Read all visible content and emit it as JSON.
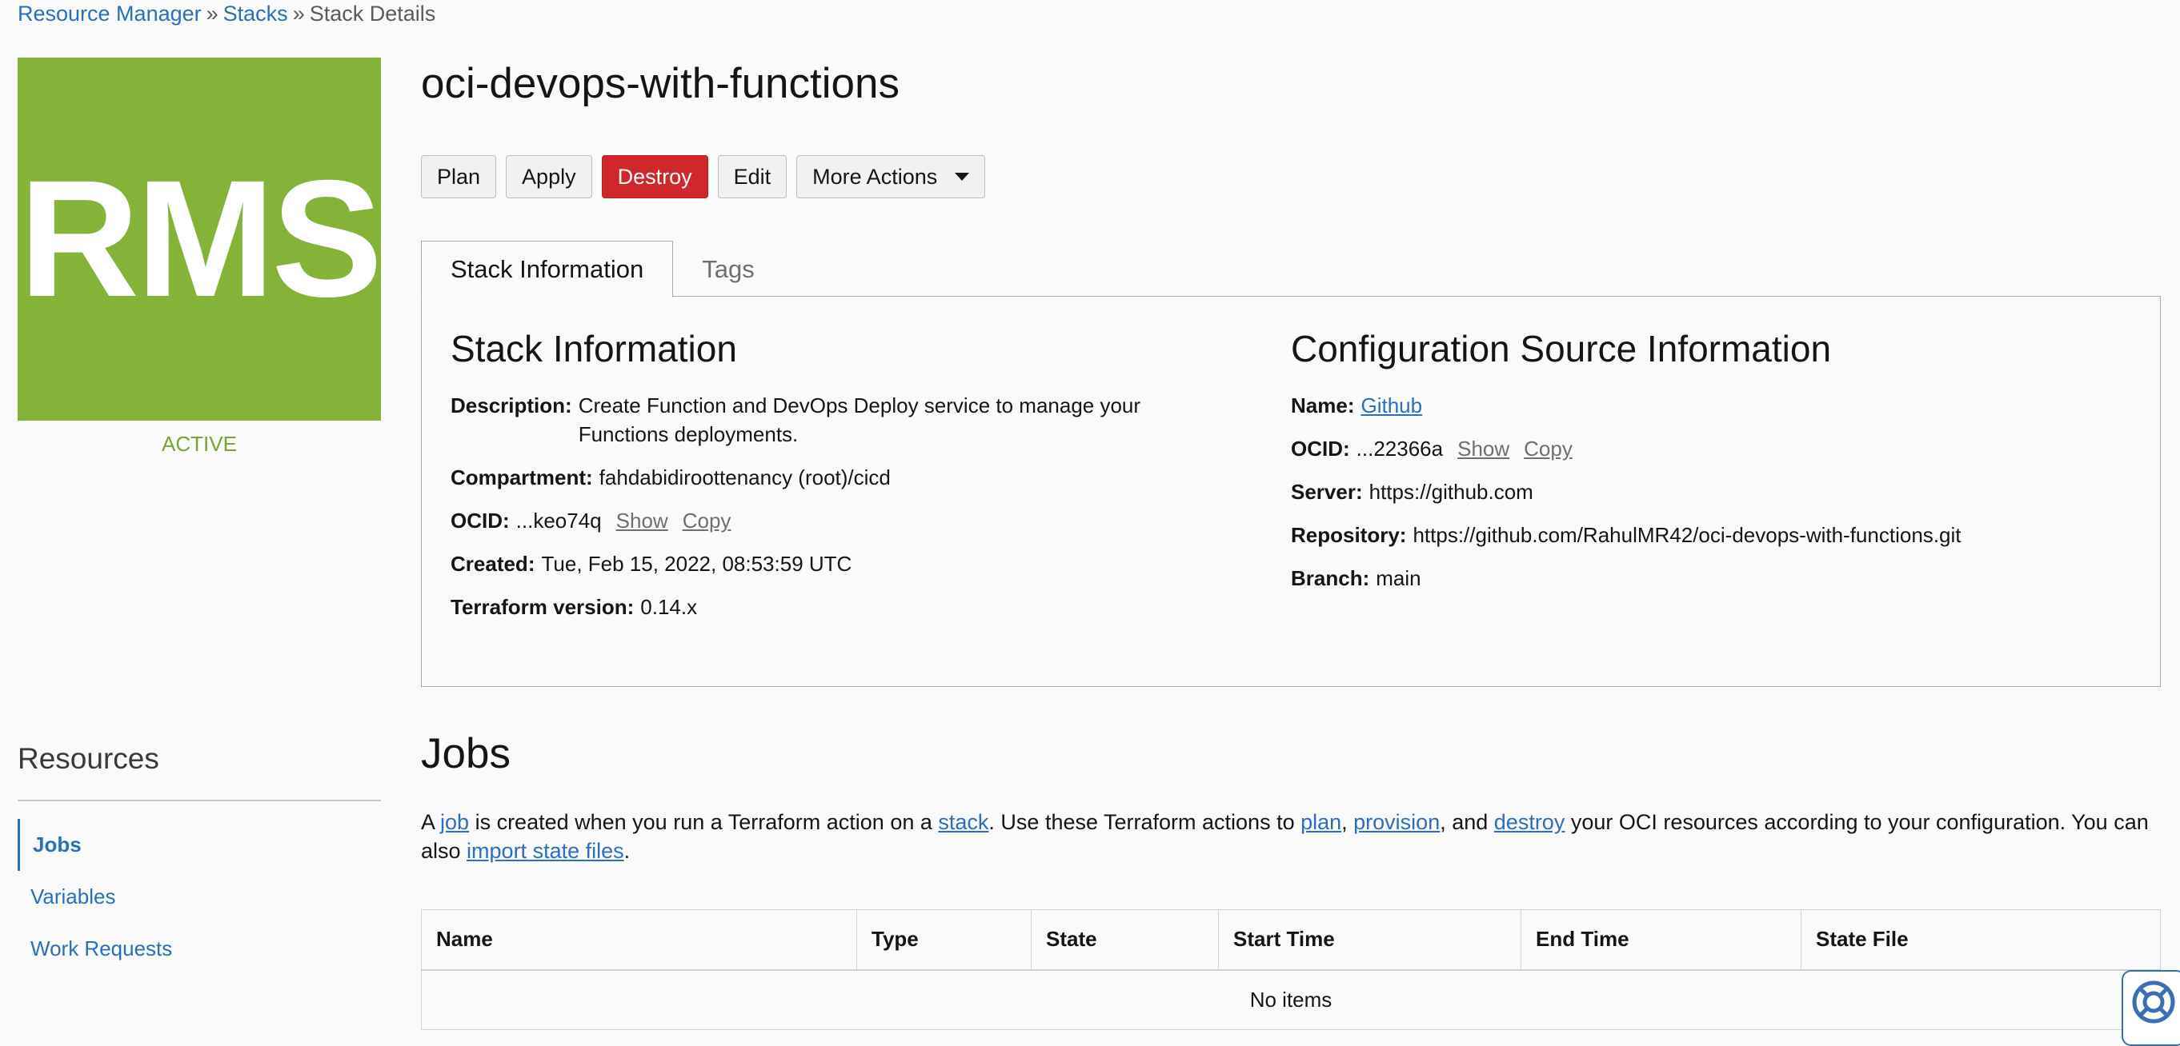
{
  "breadcrumb": {
    "items": [
      "Resource Manager",
      "Stacks",
      "Stack Details"
    ],
    "separator": "»"
  },
  "logo": {
    "text": "RMS",
    "color": "#85b33a"
  },
  "status": "ACTIVE",
  "title": "oci-devops-with-functions",
  "actions": {
    "plan": "Plan",
    "apply": "Apply",
    "destroy": "Destroy",
    "edit": "Edit",
    "more": "More Actions"
  },
  "tabs": [
    "Stack Information",
    "Tags"
  ],
  "stack_info": {
    "heading": "Stack Information",
    "description_label": "Description:",
    "description": "Create Function and DevOps Deploy service to manage your Functions deployments.",
    "compartment_label": "Compartment:",
    "compartment": "fahdabidiroottenancy (root)/cicd",
    "ocid_label": "OCID:",
    "ocid": "...keo74q",
    "show": "Show",
    "copy": "Copy",
    "created_label": "Created:",
    "created": "Tue, Feb 15, 2022, 08:53:59 UTC",
    "tf_label": "Terraform version:",
    "tf_version": "0.14.x"
  },
  "config_source": {
    "heading": "Configuration Source Information",
    "name_label": "Name:",
    "name": "Github",
    "ocid_label": "OCID:",
    "ocid": "...22366a",
    "show": "Show",
    "copy": "Copy",
    "server_label": "Server:",
    "server": "https://github.com",
    "repo_label": "Repository:",
    "repo": "https://github.com/RahulMR42/oci-devops-with-functions.git",
    "branch_label": "Branch:",
    "branch": "main"
  },
  "resources": {
    "title": "Resources",
    "items": [
      "Jobs",
      "Variables",
      "Work Requests"
    ]
  },
  "jobs": {
    "title": "Jobs",
    "desc": {
      "t1": "A ",
      "l1": "job",
      "t2": " is created when you run a Terraform action on a ",
      "l2": "stack",
      "t3": ". Use these Terraform actions to ",
      "l3": "plan",
      "t4": ", ",
      "l4": "provision",
      "t5": ", and ",
      "l5": "destroy",
      "t6": " your OCI resources according to your configuration. You can also ",
      "l6": "import state files",
      "t7": "."
    },
    "columns": [
      "Name",
      "Type",
      "State",
      "Start Time",
      "End Time",
      "State File"
    ],
    "empty": "No items"
  },
  "help_icon": "lifebuoy-icon"
}
